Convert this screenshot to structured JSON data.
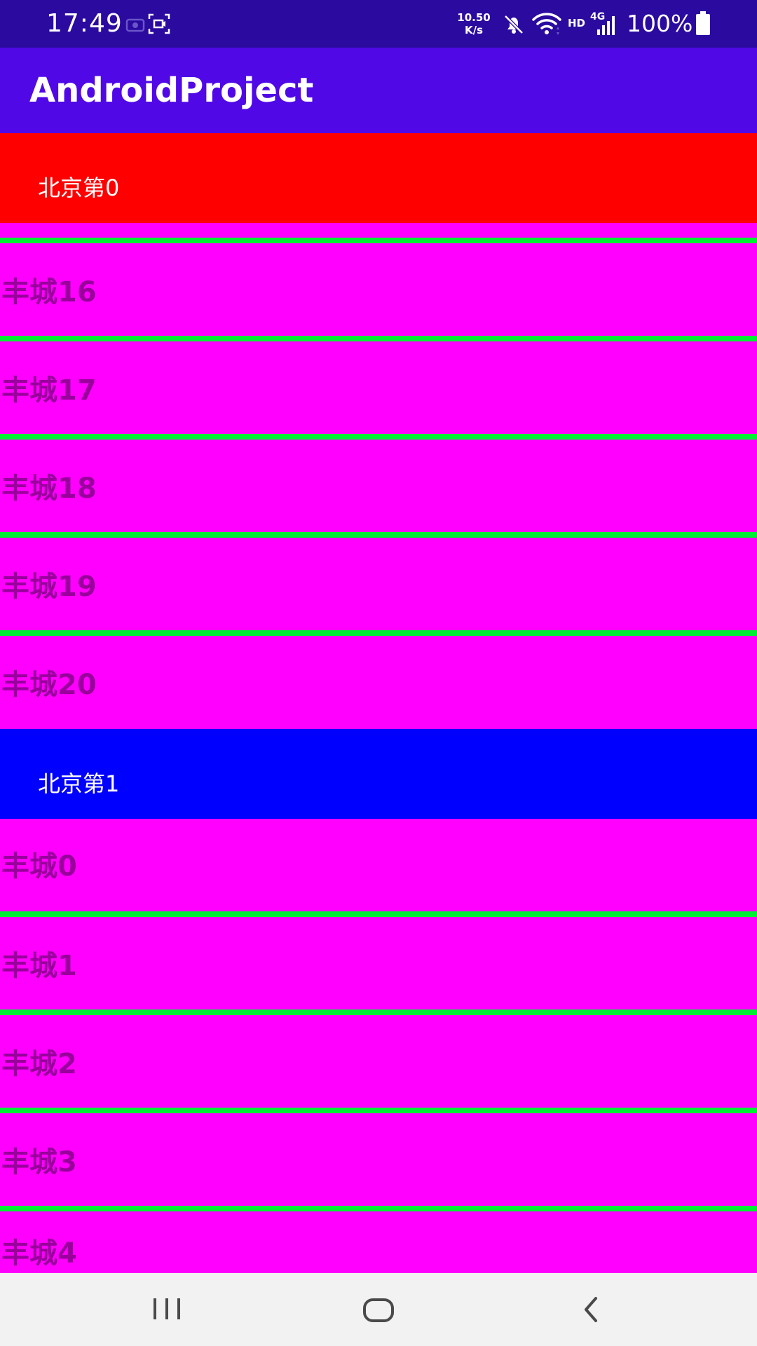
{
  "status_bar": {
    "time": "17:49",
    "net_speed_value": "10.50",
    "net_speed_unit": "K/s",
    "hd_label": "HD",
    "net_type": "4G",
    "battery_percent": "100%",
    "icons": [
      "screenshot-icon",
      "screen-record-icon",
      "mute-icon",
      "wifi-icon",
      "signal-icon",
      "battery-icon"
    ]
  },
  "app_bar": {
    "title": "AndroidProject",
    "color": "#5008e6"
  },
  "list": {
    "sections": [
      {
        "header": "北京第0",
        "header_color": "#ff0000",
        "items": [
          "丰城16",
          "丰城17",
          "丰城18",
          "丰城19",
          "丰城20"
        ]
      },
      {
        "header": "北京第1",
        "header_color": "#0000ff",
        "items": [
          "丰城0",
          "丰城1",
          "丰城2",
          "丰城3",
          "丰城4"
        ]
      }
    ],
    "row_color": "#ff00ff",
    "divider_color": "#00ee33"
  },
  "nav_bar": {
    "buttons": [
      "recent-apps-icon",
      "home-icon",
      "back-icon"
    ]
  }
}
